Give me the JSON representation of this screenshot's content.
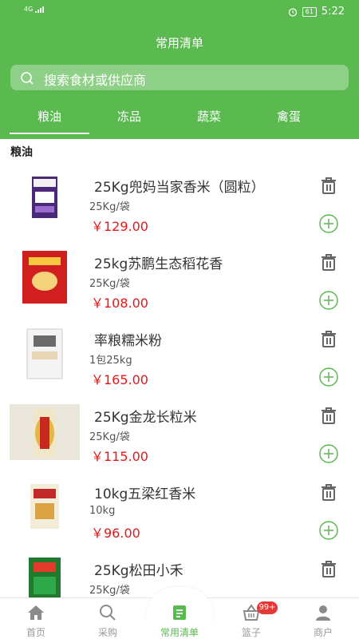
{
  "status_bar": {
    "signal": "4G",
    "battery": "61",
    "time": "5:22"
  },
  "header": {
    "title": "常用清单",
    "search_placeholder": "搜索食材或供应商"
  },
  "tabs": [
    {
      "label": "粮油",
      "active": true
    },
    {
      "label": "冻品",
      "active": false
    },
    {
      "label": "蔬菜",
      "active": false
    },
    {
      "label": "禽蛋",
      "active": false
    }
  ],
  "section": {
    "title": "粮油"
  },
  "products": [
    {
      "name": "25Kg兜妈当家香米（圆粒）",
      "spec": "25Kg/袋",
      "price": "￥129.00"
    },
    {
      "name": "25kg苏鹏生态稻花香",
      "spec": "25Kg/袋",
      "price": "￥108.00"
    },
    {
      "name": "率粮糯米粉",
      "spec": "1包25kg",
      "price": "￥165.00"
    },
    {
      "name": "25Kg金龙长粒米",
      "spec": "25Kg/袋",
      "price": "￥115.00"
    },
    {
      "name": "10kg五梁红香米",
      "spec": "10kg",
      "price": "￥96.00"
    },
    {
      "name": "25Kg松田小禾",
      "spec": "25Kg/袋",
      "price": ""
    }
  ],
  "bottom_nav": [
    {
      "label": "首页",
      "icon": "home-icon"
    },
    {
      "label": "采购",
      "icon": "search-icon"
    },
    {
      "label": "常用清单",
      "icon": "list-icon",
      "active": true
    },
    {
      "label": "篮子",
      "icon": "basket-icon",
      "badge": "99+"
    },
    {
      "label": "商户",
      "icon": "user-icon"
    }
  ],
  "colors": {
    "brand_green": "#5ab94f",
    "price_red": "#e21918",
    "badge_red": "#e53935"
  }
}
